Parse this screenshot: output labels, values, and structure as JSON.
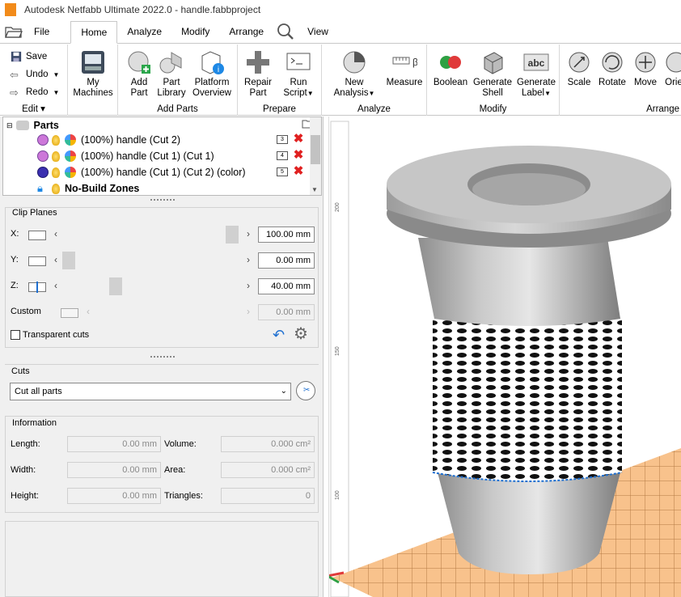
{
  "window": {
    "title": "Autodesk Netfabb Ultimate 2022.0 - handle.fabbproject"
  },
  "menu": {
    "file": "File",
    "tabs": [
      "Home",
      "Analyze",
      "Modify",
      "Arrange"
    ],
    "view": "View"
  },
  "ribbon": {
    "edit": {
      "save": "Save",
      "undo": "Undo",
      "redo": "Redo",
      "group": "Edit"
    },
    "machines": {
      "label1": "My",
      "label2": "Machines"
    },
    "add_parts": {
      "add_part1": "Add",
      "add_part2": "Part",
      "library1": "Part",
      "library2": "Library",
      "platform1": "Platform",
      "platform2": "Overview",
      "group": "Add Parts"
    },
    "prepare": {
      "repair1": "Repair",
      "repair2": "Part",
      "script1": "Run",
      "script2": "Script",
      "group": "Prepare"
    },
    "analyze": {
      "new1": "New",
      "new2": "Analysis",
      "measure": "Measure",
      "group": "Analyze"
    },
    "modify": {
      "boolean": "Boolean",
      "shell1": "Generate",
      "shell2": "Shell",
      "label1": "Generate",
      "label2": "Label",
      "group": "Modify"
    },
    "arrange": {
      "scale": "Scale",
      "rotate": "Rotate",
      "move": "Move",
      "orient": "Orie",
      "group": "Arrange"
    }
  },
  "tree": {
    "root": "Parts",
    "items": [
      {
        "label": "(100%) handle (Cut 2)",
        "num": "3",
        "color": "#cc77d9"
      },
      {
        "label": "(100%) handle (Cut 1) (Cut 1)",
        "num": "4",
        "color": "#cc77d9"
      },
      {
        "label": "(100%) handle (Cut 1) (Cut 2) (color)",
        "num": "5",
        "color": "#3a2fb0"
      }
    ],
    "nobuild": "No-Build Zones"
  },
  "clip": {
    "title": "Clip Planes",
    "x_label": "X:",
    "x_value": "100.00 mm",
    "y_label": "Y:",
    "y_value": "0.00 mm",
    "z_label": "Z:",
    "z_value": "40.00 mm",
    "custom_label": "Custom",
    "custom_value": "0.00 mm",
    "transparent": "Transparent cuts"
  },
  "cuts": {
    "title": "Cuts",
    "selected": "Cut all parts"
  },
  "info": {
    "title": "Information",
    "length_label": "Length:",
    "length": "0.00 mm",
    "width_label": "Width:",
    "width": "0.00 mm",
    "height_label": "Height:",
    "height": "0.00 mm",
    "volume_label": "Volume:",
    "volume": "0.000 cm²",
    "area_label": "Area:",
    "area": "0.000 cm²",
    "triangles_label": "Triangles:",
    "triangles": "0"
  },
  "viewport": {
    "ruler_labels": [
      "200",
      "150",
      "100"
    ]
  }
}
